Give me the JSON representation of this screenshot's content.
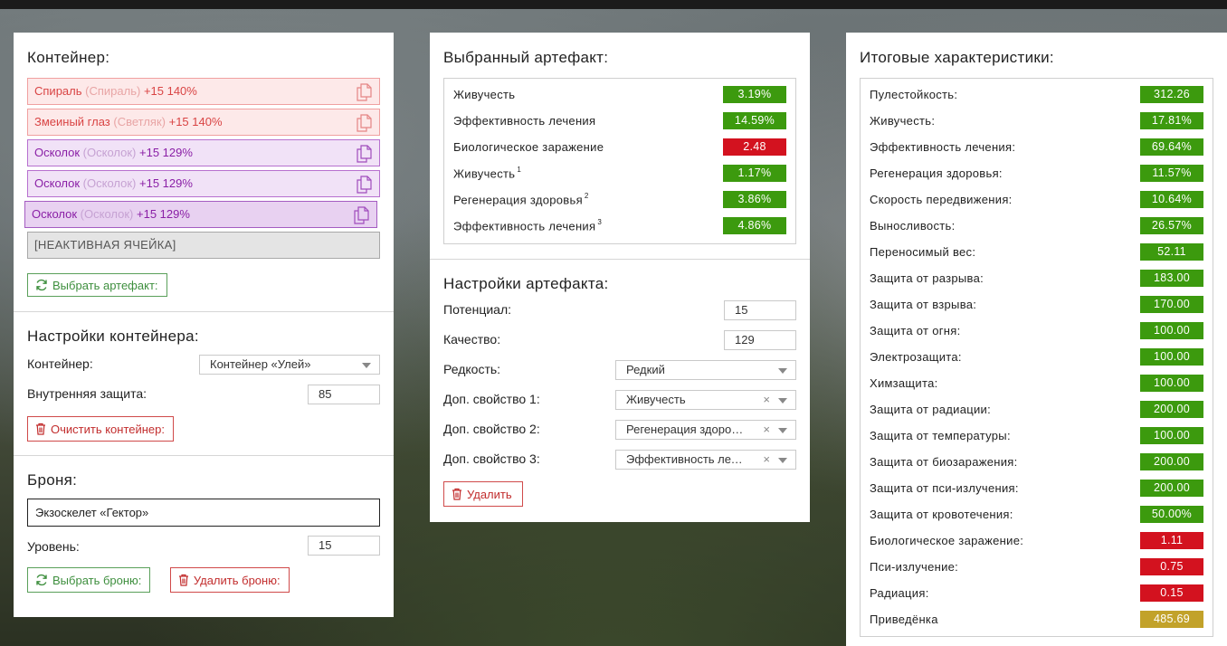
{
  "container": {
    "title": "Контейнер:",
    "slots": [
      {
        "name": "Спираль",
        "orig": "(Спираль)",
        "bonus": "+15 140%",
        "color": "red"
      },
      {
        "name": "Змеиный глаз",
        "orig": "(Светляк)",
        "bonus": "+15 140%",
        "color": "red"
      },
      {
        "name": "Осколок",
        "orig": "(Осколок)",
        "bonus": "+15 129%",
        "color": "purple"
      },
      {
        "name": "Осколок",
        "orig": "(Осколок)",
        "bonus": "+15 129%",
        "color": "purple"
      },
      {
        "name": "Осколок",
        "orig": "(Осколок)",
        "bonus": "+15 129%",
        "color": "purple",
        "selected": true
      }
    ],
    "inactive_slot": "[НЕАКТИВНАЯ ЯЧЕЙКА]",
    "select_artifact_label": "Выбрать артефакт:"
  },
  "container_settings": {
    "title": "Настройки контейнера:",
    "container_label": "Контейнер:",
    "container_value": "Контейнер «Улей»",
    "protection_label": "Внутренняя защита:",
    "protection_value": "85",
    "clear_label": "Очистить контейнер:"
  },
  "armor": {
    "title": "Броня:",
    "value": "Экзоскелет «Гектор»",
    "level_label": "Уровень:",
    "level_value": "15",
    "select_label": "Выбрать броню:",
    "delete_label": "Удалить броню:"
  },
  "selected_artifact": {
    "title": "Выбранный артефакт:",
    "stats": [
      {
        "name": "Живучесть",
        "sup": "",
        "value": "3.19%",
        "color": "green"
      },
      {
        "name": "Эффективность лечения",
        "sup": "",
        "value": "14.59%",
        "color": "green"
      },
      {
        "name": "Биологическое заражение",
        "sup": "",
        "value": "2.48",
        "color": "red"
      },
      {
        "name": "Живучесть",
        "sup": "1",
        "value": "1.17%",
        "color": "green"
      },
      {
        "name": "Регенерация здоровья",
        "sup": "2",
        "value": "3.86%",
        "color": "green"
      },
      {
        "name": "Эффективность лечения",
        "sup": "3",
        "value": "4.86%",
        "color": "green"
      }
    ]
  },
  "artifact_settings": {
    "title": "Настройки артефакта:",
    "potential_label": "Потенциал:",
    "potential_value": "15",
    "quality_label": "Качество:",
    "quality_value": "129",
    "rarity_label": "Редкость:",
    "rarity_value": "Редкий",
    "prop1_label": "Доп. свойство 1:",
    "prop1_value": "Живучесть",
    "prop2_label": "Доп. свойство 2:",
    "prop2_value": "Регенерация здоровья",
    "prop3_label": "Доп. свойство 3:",
    "prop3_value": "Эффективность лечения",
    "clear_glyph": "×",
    "delete_label": "Удалить"
  },
  "totals": {
    "title": "Итоговые характеристики:",
    "stats": [
      {
        "name": "Пулестойкость:",
        "value": "312.26",
        "color": "green"
      },
      {
        "name": "Живучесть:",
        "value": "17.81%",
        "color": "green"
      },
      {
        "name": "Эффективность лечения:",
        "value": "69.64%",
        "color": "green"
      },
      {
        "name": "Регенерация здоровья:",
        "value": "11.57%",
        "color": "green"
      },
      {
        "name": "Скорость передвижения:",
        "value": "10.64%",
        "color": "green"
      },
      {
        "name": "Выносливость:",
        "value": "26.57%",
        "color": "green"
      },
      {
        "name": "Переносимый вес:",
        "value": "52.11",
        "color": "green"
      },
      {
        "name": "Защита от разрыва:",
        "value": "183.00",
        "color": "green"
      },
      {
        "name": "Защита от взрыва:",
        "value": "170.00",
        "color": "green"
      },
      {
        "name": "Защита от огня:",
        "value": "100.00",
        "color": "green"
      },
      {
        "name": "Электрозащита:",
        "value": "100.00",
        "color": "green"
      },
      {
        "name": "Химзащита:",
        "value": "100.00",
        "color": "green"
      },
      {
        "name": "Защита от радиации:",
        "value": "200.00",
        "color": "green"
      },
      {
        "name": "Защита от температуры:",
        "value": "100.00",
        "color": "green"
      },
      {
        "name": "Защита от биозаражения:",
        "value": "200.00",
        "color": "green"
      },
      {
        "name": "Защита от пси-излучения:",
        "value": "200.00",
        "color": "green"
      },
      {
        "name": "Защита от кровотечения:",
        "value": "50.00%",
        "color": "green"
      },
      {
        "name": "Биологическое заражение:",
        "value": "1.11",
        "color": "red"
      },
      {
        "name": "Пси-излучение:",
        "value": "0.75",
        "color": "red"
      },
      {
        "name": "Радиация:",
        "value": "0.15",
        "color": "red"
      },
      {
        "name": "Приведёнка",
        "value": "485.69",
        "color": "gold"
      }
    ]
  },
  "colors": {
    "green": "#3c9a0e",
    "red": "#d3121f",
    "gold": "#c2a22a",
    "slot_red": "#d94444",
    "slot_purple": "#8a1fa6"
  }
}
